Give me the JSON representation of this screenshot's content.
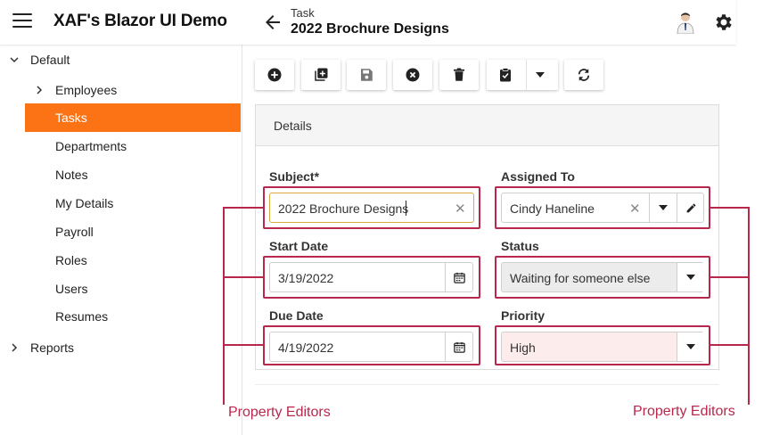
{
  "header": {
    "app_title": "XAF's Blazor UI Demo",
    "breadcrumb": "Task",
    "view_title": "2022 Brochure Designs"
  },
  "sidebar": {
    "groups": [
      {
        "label": "Default"
      },
      {
        "label": "Reports"
      }
    ],
    "items": [
      {
        "label": "Employees"
      },
      {
        "label": "Tasks"
      },
      {
        "label": "Departments"
      },
      {
        "label": "Notes"
      },
      {
        "label": "My Details"
      },
      {
        "label": "Payroll"
      },
      {
        "label": "Roles"
      },
      {
        "label": "Users"
      },
      {
        "label": "Resumes"
      }
    ],
    "active_item": "Tasks",
    "accent_color": "#fc7315"
  },
  "toolbar": {
    "icons": [
      "add-icon",
      "clone-icon",
      "save-icon",
      "close-icon",
      "delete-icon",
      "validate-icon",
      "dropdown-icon",
      "refresh-icon"
    ]
  },
  "details": {
    "title": "Details",
    "subject_label": "Subject*",
    "subject_value": "2022 Brochure Designs",
    "assigned_label": "Assigned To",
    "assigned_value": "Cindy Haneline",
    "start_label": "Start Date",
    "start_value": "3/19/2022",
    "status_label": "Status",
    "status_value": "Waiting for someone else",
    "due_label": "Due Date",
    "due_value": "4/19/2022",
    "priority_label": "Priority",
    "priority_value": "High"
  },
  "annotations": {
    "left": "Property Editors",
    "right": "Property Editors",
    "color": "#b8284d"
  }
}
